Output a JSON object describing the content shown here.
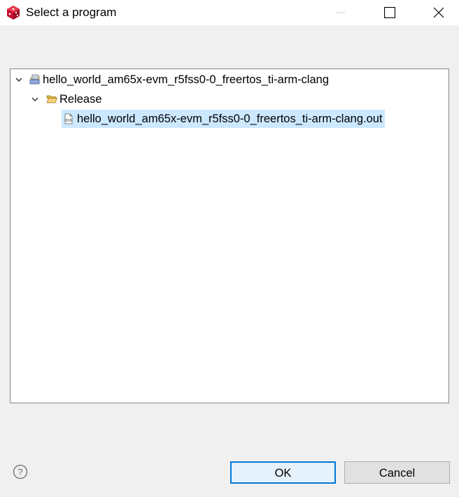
{
  "window": {
    "title": "Select a program",
    "icons": {
      "app": "app-cube-icon",
      "minimize": "minimize-icon",
      "maximize": "maximize-icon",
      "close": "close-icon"
    }
  },
  "tree": {
    "project": {
      "label": "hello_world_am65x-evm_r5fss0-0_freertos_ti-arm-clang",
      "icon": "project-icon",
      "expanded": true
    },
    "folder": {
      "label": "Release",
      "icon": "open-folder-icon",
      "expanded": true
    },
    "file": {
      "label": "hello_world_am65x-evm_r5fss0-0_freertos_ti-arm-clang.out",
      "icon": "binary-file-icon",
      "selected": true
    }
  },
  "footer": {
    "help_icon": "help-icon",
    "ok_label": "OK",
    "cancel_label": "Cancel"
  },
  "colors": {
    "selection": "#cce8ff",
    "ok_border": "#0078d7",
    "app_icon": "#c8102e"
  }
}
